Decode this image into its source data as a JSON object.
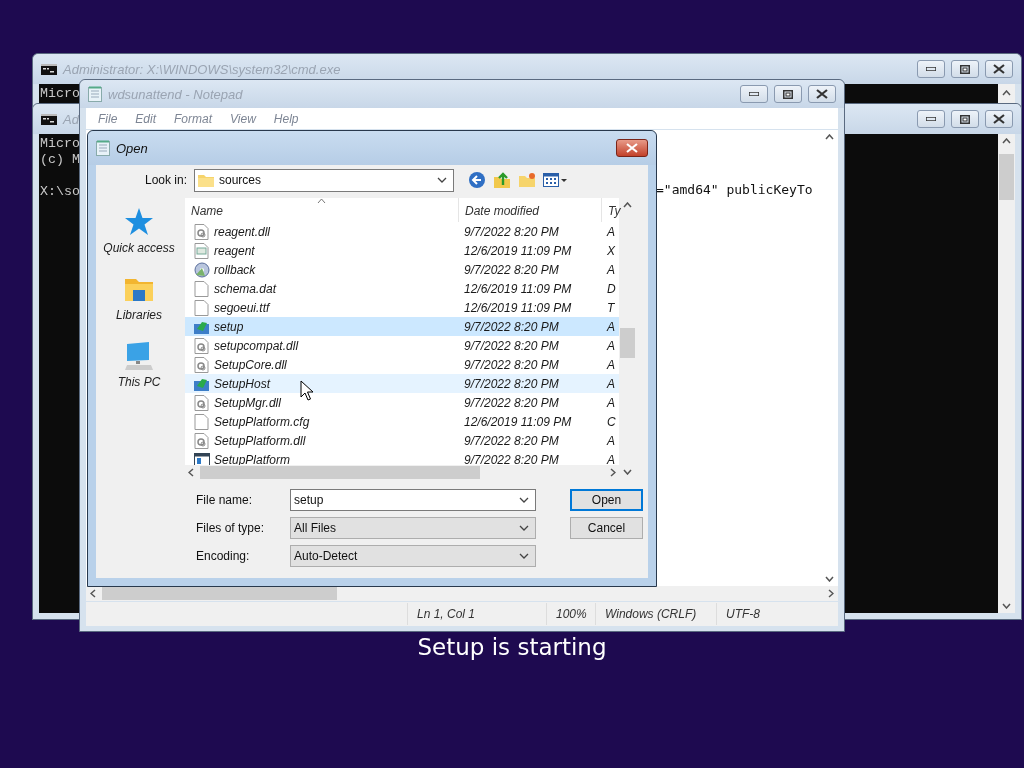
{
  "consoles": [
    {
      "title": "Administrator: X:\\WINDOWS\\system32\\cmd.exe",
      "paragraphs": [
        [
          "Micro"
        ]
      ]
    },
    {
      "title": "Ad",
      "paragraphs": [
        [
          "Micro",
          "(c) M"
        ],
        [
          "X:\\so"
        ]
      ]
    }
  ],
  "notepad": {
    "title": "wdsunattend - Notepad",
    "menu": [
      "File",
      "Edit",
      "Format",
      "View",
      "Help"
    ],
    "text_lines": [
      "=\"amd64\" publicKeyTo"
    ],
    "status_bar": [
      "Ln 1, Col 1",
      "100%",
      "Windows (CRLF)",
      "UTF-8"
    ]
  },
  "open_dialog": {
    "title": "Open",
    "look_in": {
      "label": "Look in:",
      "value": "sources"
    },
    "places": [
      {
        "label": "Quick access",
        "kind": "star"
      },
      {
        "label": "Libraries",
        "kind": "library"
      },
      {
        "label": "This PC",
        "kind": "computer"
      }
    ],
    "columns": [
      "Name",
      "Date modified",
      "Ty"
    ],
    "rows": [
      {
        "name": "reagent.dll",
        "date": "9/7/2022 8:20 PM",
        "type": "A",
        "kind": "dll",
        "selected": false,
        "hovered": false
      },
      {
        "name": "reagent",
        "date": "12/6/2019 11:09 PM",
        "type": "X",
        "kind": "xml",
        "selected": false,
        "hovered": false
      },
      {
        "name": "rollback",
        "date": "9/7/2022 8:20 PM",
        "type": "A",
        "kind": "disc",
        "selected": false,
        "hovered": false
      },
      {
        "name": "schema.dat",
        "date": "12/6/2019 11:09 PM",
        "type": "D",
        "kind": "file",
        "selected": false,
        "hovered": false
      },
      {
        "name": "segoeui.ttf",
        "date": "12/6/2019 11:09 PM",
        "type": "T",
        "kind": "file",
        "selected": false,
        "hovered": false
      },
      {
        "name": "setup",
        "date": "9/7/2022 8:20 PM",
        "type": "A",
        "kind": "app",
        "selected": true,
        "hovered": false
      },
      {
        "name": "setupcompat.dll",
        "date": "9/7/2022 8:20 PM",
        "type": "A",
        "kind": "dll",
        "selected": false,
        "hovered": false
      },
      {
        "name": "SetupCore.dll",
        "date": "9/7/2022 8:20 PM",
        "type": "A",
        "kind": "dll",
        "selected": false,
        "hovered": false
      },
      {
        "name": "SetupHost",
        "date": "9/7/2022 8:20 PM",
        "type": "A",
        "kind": "app",
        "selected": false,
        "hovered": true
      },
      {
        "name": "SetupMgr.dll",
        "date": "9/7/2022 8:20 PM",
        "type": "A",
        "kind": "dll",
        "selected": false,
        "hovered": false
      },
      {
        "name": "SetupPlatform.cfg",
        "date": "12/6/2019 11:09 PM",
        "type": "C",
        "kind": "file",
        "selected": false,
        "hovered": false
      },
      {
        "name": "SetupPlatform.dll",
        "date": "9/7/2022 8:20 PM",
        "type": "A",
        "kind": "dll",
        "selected": false,
        "hovered": false
      },
      {
        "name": "SetupPlatform",
        "date": "9/7/2022 8:20 PM",
        "type": "A",
        "kind": "window",
        "selected": false,
        "hovered": false
      }
    ],
    "fields": [
      {
        "label": "File name:",
        "value": "setup",
        "editable": true
      },
      {
        "label": "Files of type:",
        "value": "All Files",
        "editable": false
      },
      {
        "label": "Encoding:",
        "value": "Auto-Detect",
        "editable": false
      }
    ],
    "buttons": [
      {
        "label": "Open",
        "default": true
      },
      {
        "label": "Cancel",
        "default": false
      }
    ]
  },
  "caption": "Setup is starting"
}
